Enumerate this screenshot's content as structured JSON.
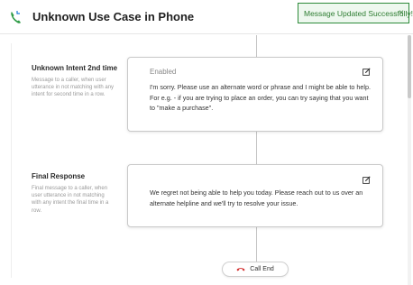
{
  "header": {
    "title": "Unknown Use Case in Phone",
    "icon": "phone-icon"
  },
  "toast": {
    "message": "Message Updated Successfully!",
    "close": "×",
    "color": "#2e7d32"
  },
  "sections": [
    {
      "title": "Unknown Intent 2nd time",
      "description": "Message to a caller, when user utterance in not matching with any intent for second time in a row.",
      "status": "Enabled",
      "message": "I'm sorry. Please use an alternate word or phrase and I might be able to help. For e.g. - if you are trying to place an order, you can try saying that you want to \"make a purchase\"."
    },
    {
      "title": "Final Response",
      "description": "Final message to a caller, when user utterance in not matching with any intent the final time in a row.",
      "message": "We regret not being able to help you today. Please reach out to us over an alternate helpline and we'll try to resolve your issue."
    }
  ],
  "call_end": {
    "label": "Call End",
    "icon": "phone-hangup-icon",
    "icon_color": "#d32f2f"
  }
}
